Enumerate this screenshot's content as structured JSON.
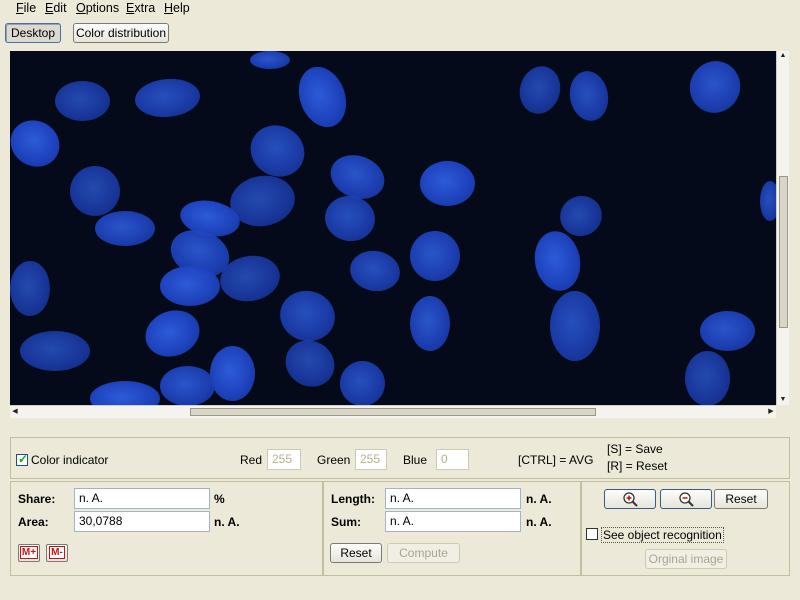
{
  "menu": [
    "File",
    "Edit",
    "Options",
    "Extra",
    "Help"
  ],
  "views": {
    "desktop": "Desktop",
    "color_distribution": "Color distribution"
  },
  "color_panel": {
    "indicator_label": "Color indicator",
    "indicator_checked": true,
    "red_label": "Red",
    "red_value": "255",
    "green_label": "Green",
    "green_value": "255",
    "blue_label": "Blue",
    "blue_value": "0",
    "ctrl_hint": "[CTRL] = AVG",
    "save_hint": "[S] = Save",
    "reset_hint": "[R] = Reset"
  },
  "share_panel": {
    "share_label": "Share:",
    "share_value": "n. A.",
    "share_unit": "%",
    "area_label": "Area:",
    "area_value": "30,0788",
    "area_unit": "n. A.",
    "mplus": "M+",
    "mminus": "M-"
  },
  "length_panel": {
    "length_label": "Length:",
    "length_value": "n. A.",
    "length_unit": "n. A.",
    "sum_label": "Sum:",
    "sum_value": "n. A.",
    "sum_unit": "n. A.",
    "reset": "Reset",
    "compute": "Compute"
  },
  "zoom_panel": {
    "reset": "Reset",
    "see_object_recognition": "See object recognition",
    "original_image": "Orginal image"
  },
  "colors": {
    "background": "#ece9d8",
    "image_bg": "#050a1a",
    "cell": "#1f45c4"
  }
}
